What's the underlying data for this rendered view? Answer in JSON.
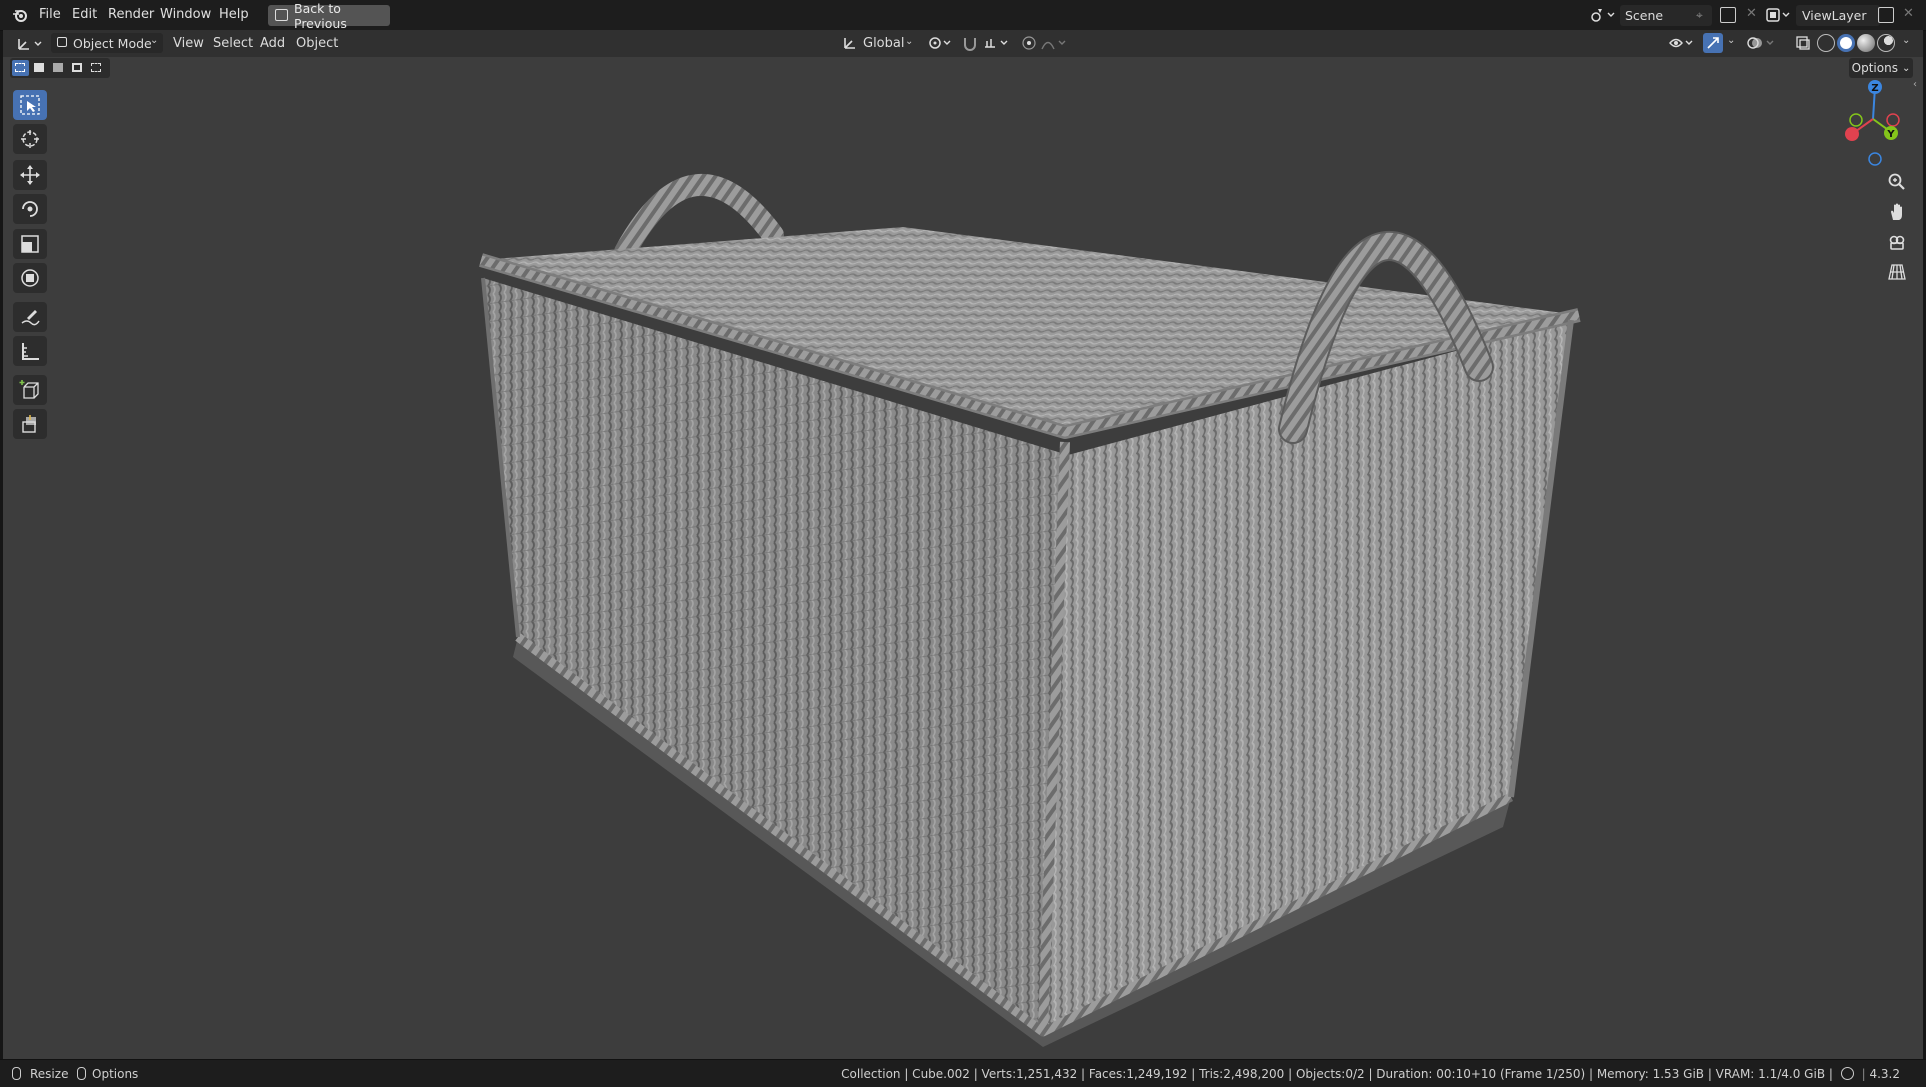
{
  "menubar": {
    "items": [
      "File",
      "Edit",
      "Render",
      "Window",
      "Help"
    ],
    "back_button": "Back to Previous",
    "scene_label": "Scene",
    "view_layer_label": "ViewLayer"
  },
  "header": {
    "mode_label": "Object Mode",
    "menus": [
      "View",
      "Select",
      "Add",
      "Object"
    ],
    "transform_orientation": "Global",
    "options_label": "Options"
  },
  "toolbar": {
    "tools": [
      "select-box",
      "cursor",
      "move",
      "rotate",
      "scale",
      "transform",
      "annotate",
      "measure",
      "add-cube",
      "extrude"
    ]
  },
  "gizmo": {
    "axes": {
      "z": "Z",
      "y": "Y"
    },
    "colors": {
      "x": "#e0424f",
      "y": "#84c51b",
      "z": "#3b86e0"
    }
  },
  "statusbar": {
    "left_items": [
      "Resize",
      "Options"
    ],
    "info": "Collection | Cube.002 | Verts:1,251,432 | Faces:1,249,192 | Tris:2,498,200 | Objects:0/2 | Duration: 00:10+10 (Frame 1/250) | Memory: 1.53 GiB | VRAM: 1.1/4.0 GiB |",
    "version": "4.3.2"
  },
  "viewport": {
    "background": "#3d3d3d",
    "object": "woven-basket"
  }
}
